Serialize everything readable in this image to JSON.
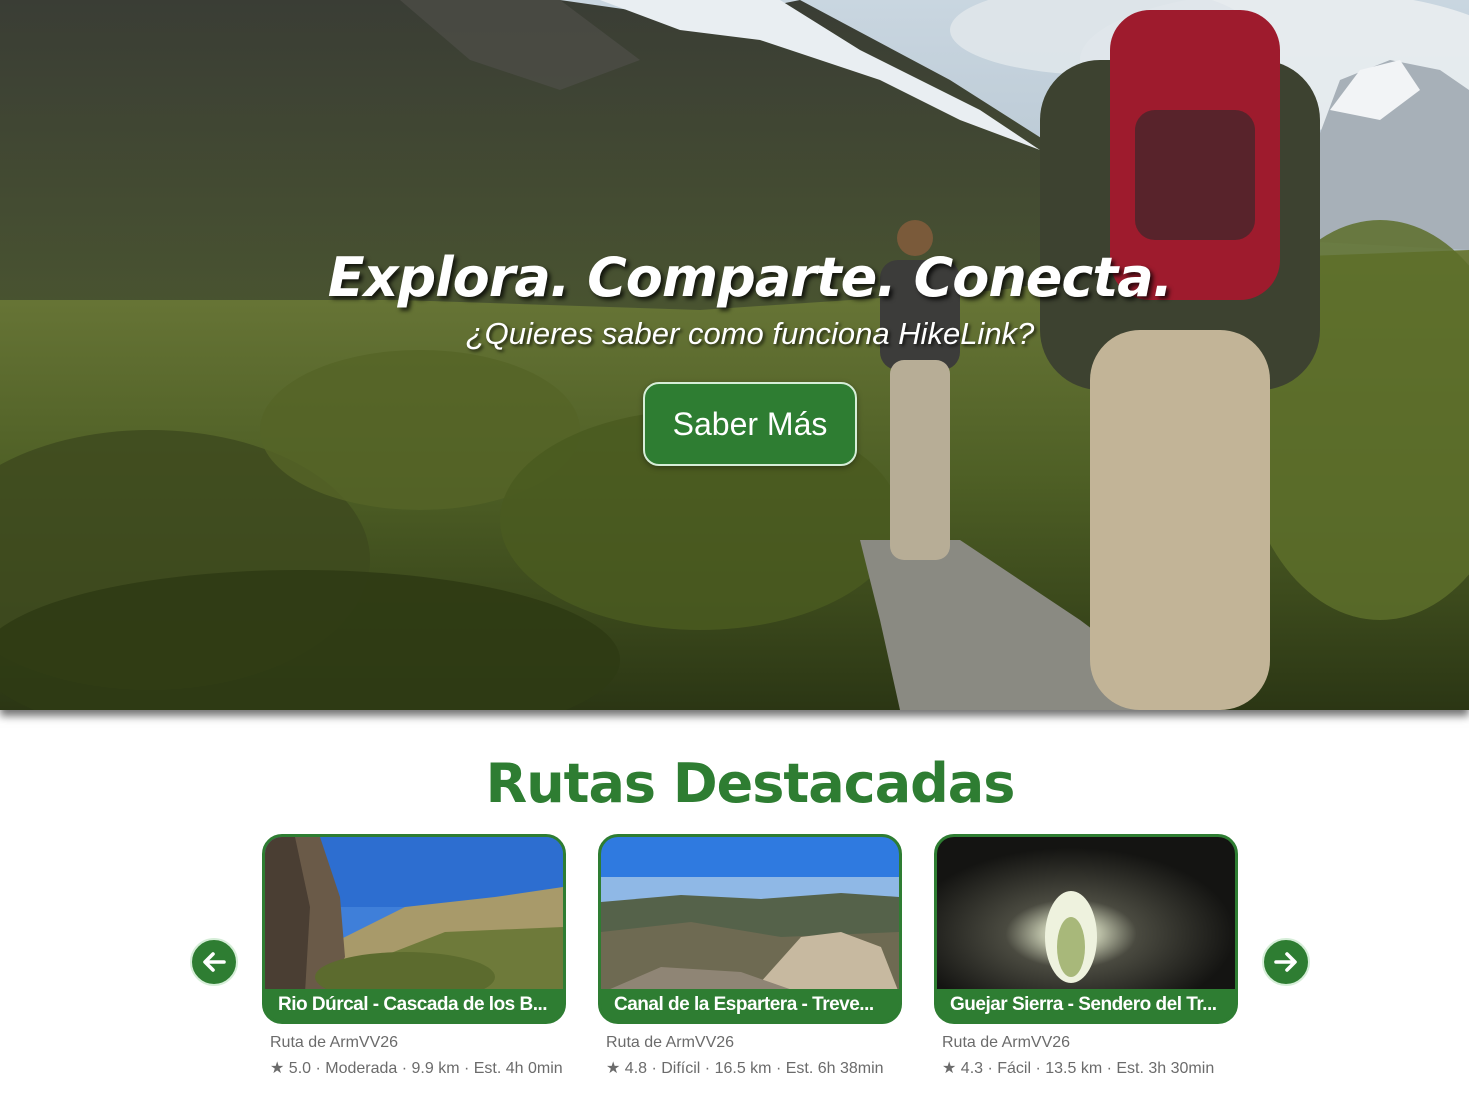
{
  "hero": {
    "title": "Explora. Comparte. Conecta.",
    "subtitle": "¿Quieres saber como funciona HikeLink?",
    "button_label": "Saber Más",
    "image": "mountain-hikers-photo"
  },
  "featured": {
    "title": "Rutas Destacadas",
    "prev_icon": "arrow-left-icon",
    "next_icon": "arrow-right-icon",
    "routes": [
      {
        "name": "Rio Dúrcal - Cascada de los B...",
        "author": "Ruta de ArmVV26",
        "meta": "★ 5.0 · Moderada · 9.9 km · Est. 4h 0min",
        "image": "canyon-rock-photo"
      },
      {
        "name": "Canal de la Espartera - Treve...",
        "author": "Ruta de ArmVV26",
        "meta": "★ 4.8 · Difícil · 16.5 km · Est. 6h 38min",
        "image": "mountain-panorama-photo"
      },
      {
        "name": "Guejar Sierra - Sendero del Tr...",
        "author": "Ruta de ArmVV26",
        "meta": "★ 4.3 · Fácil · 13.5 km · Est. 3h 30min",
        "image": "rock-tunnel-photo"
      }
    ]
  },
  "colors": {
    "brand_green": "#2e7d32",
    "text_gray": "#6b6b6b"
  }
}
